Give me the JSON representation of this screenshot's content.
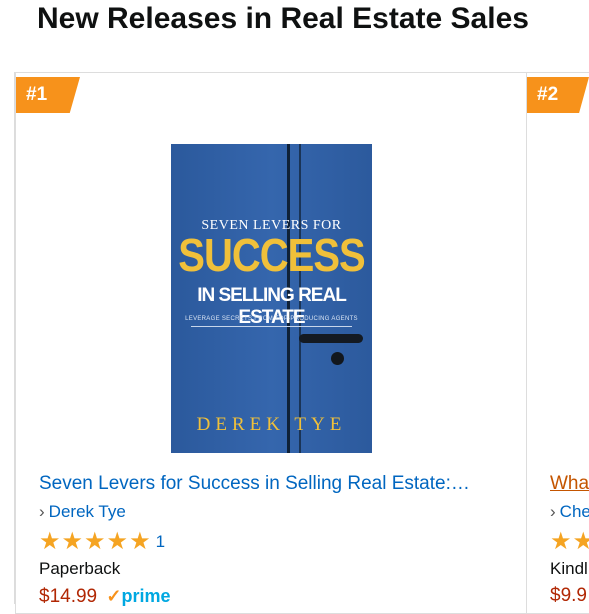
{
  "header": {
    "title": "New Releases in Real Estate Sales"
  },
  "products": [
    {
      "rank": "#1",
      "cover": {
        "top_line": "SEVEN LEVERS FOR",
        "big_word": "SUCCESS",
        "sub_line": "IN SELLING REAL ESTATE",
        "tagline": "LEVERAGE SECRETS FROM TOP-PRODUCING AGENTS",
        "author": "DEREK TYE",
        "background_color": "#2e5fa3",
        "accent_color": "#f0c03a"
      },
      "title": "Seven Levers for Success in Selling Real Estate:…",
      "author": "Derek Tye",
      "rating": 5,
      "rating_count": "1",
      "format": "Paperback",
      "price": "$14.99",
      "prime_label": "prime"
    },
    {
      "rank": "#2",
      "title": "Wha",
      "author": "Che",
      "rating_stars_visible": 2,
      "format": "Kindl",
      "price": "$9.9"
    }
  ],
  "colors": {
    "badge": "#f7921b",
    "link": "#0066c0",
    "price": "#b12704",
    "star": "#f5a422"
  }
}
